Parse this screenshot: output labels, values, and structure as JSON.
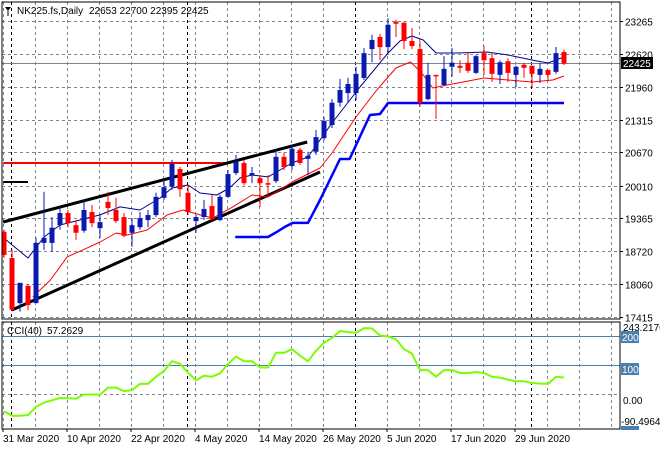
{
  "header": {
    "symbol": "NK225.fs,Daily",
    "ohlc_text": "22653 22700 22395 22425",
    "icon": "triangle-down-icon"
  },
  "colors": {
    "bull": "#0a1ab0",
    "bear": "#ff0000",
    "ma_fast": "#00008b",
    "ma_slow": "#ff0000",
    "support": "#0000ff",
    "cci": "#7cfc00",
    "level": "#4a7fb0",
    "grid": "#7a8590"
  },
  "chart_data": [
    {
      "type": "candlestick",
      "title": "NK225.fs,Daily",
      "ylim": [
        17415,
        23265
      ],
      "y_ticks": [
        "23265",
        "22620",
        "21960",
        "21315",
        "20670",
        "20010",
        "19365",
        "18720",
        "18060",
        "17415"
      ],
      "x_ticks": [
        {
          "i": 0,
          "label": "31 Mar 2020"
        },
        {
          "i": 8,
          "label": "10 Apr 2020"
        },
        {
          "i": 16,
          "label": "22 Apr 2020"
        },
        {
          "i": 24,
          "label": "4 May 2020"
        },
        {
          "i": 32,
          "label": "14 May 2020"
        },
        {
          "i": 40,
          "label": "26 May 2020"
        },
        {
          "i": 48,
          "label": "5 Jun 2020"
        },
        {
          "i": 56,
          "label": "17 Jun 2020"
        },
        {
          "i": 64,
          "label": "29 Jun 2020"
        }
      ],
      "grid": true,
      "month_separators": [
        1,
        23,
        44,
        66
      ],
      "current_price": "22425",
      "candles_ohlc": [
        [
          19100,
          19140,
          18580,
          18640
        ],
        [
          18580,
          18740,
          17540,
          17560
        ],
        [
          17690,
          18090,
          17520,
          18090
        ],
        [
          18030,
          18070,
          17550,
          17650
        ],
        [
          17690,
          18980,
          17690,
          18880
        ],
        [
          18880,
          19890,
          18740,
          18980
        ],
        [
          18880,
          19390,
          18700,
          19180
        ],
        [
          19230,
          19590,
          19140,
          19470
        ],
        [
          19470,
          19530,
          19190,
          19270
        ],
        [
          19230,
          19330,
          18940,
          19080
        ],
        [
          19120,
          19730,
          19080,
          19530
        ],
        [
          19490,
          19630,
          19190,
          19270
        ],
        [
          19170,
          19430,
          18980,
          19290
        ],
        [
          19690,
          19890,
          19430,
          19570
        ],
        [
          19530,
          19770,
          19270,
          19310
        ],
        [
          19390,
          19470,
          18990,
          19020
        ],
        [
          19080,
          19370,
          18800,
          19230
        ],
        [
          19190,
          19490,
          19140,
          19370
        ],
        [
          19330,
          19530,
          19190,
          19430
        ],
        [
          19430,
          19870,
          19390,
          19790
        ],
        [
          19770,
          20120,
          19730,
          19980
        ],
        [
          19990,
          20520,
          19930,
          20440
        ],
        [
          20340,
          20380,
          19790,
          19940
        ],
        [
          19870,
          20020,
          19430,
          19490
        ],
        [
          19310,
          19430,
          19080,
          19390
        ],
        [
          19390,
          19730,
          19330,
          19550
        ],
        [
          19610,
          19830,
          19330,
          19350
        ],
        [
          19330,
          19830,
          19310,
          19790
        ],
        [
          19790,
          20320,
          19770,
          20240
        ],
        [
          20260,
          20620,
          20220,
          20480
        ],
        [
          20460,
          20520,
          20020,
          20060
        ],
        [
          20220,
          20380,
          20060,
          20260
        ],
        [
          20160,
          20220,
          19590,
          20060
        ],
        [
          20060,
          20220,
          19790,
          20030
        ],
        [
          20100,
          20720,
          20060,
          20580
        ],
        [
          20580,
          20660,
          20320,
          20380
        ],
        [
          20400,
          20820,
          20320,
          20740
        ],
        [
          20720,
          20760,
          20420,
          20460
        ],
        [
          20540,
          20680,
          20220,
          20600
        ],
        [
          20680,
          21110,
          20620,
          20970
        ],
        [
          20950,
          21370,
          20910,
          21290
        ],
        [
          21210,
          21720,
          21150,
          21650
        ],
        [
          21650,
          22120,
          21570,
          21900
        ],
        [
          21840,
          22140,
          21650,
          22020
        ],
        [
          21840,
          22360,
          21700,
          22220
        ],
        [
          22140,
          22730,
          22100,
          22630
        ],
        [
          22710,
          22990,
          22450,
          22890
        ],
        [
          22950,
          23010,
          22490,
          22750
        ],
        [
          22750,
          23320,
          22630,
          23190
        ],
        [
          23250,
          23290,
          22950,
          23210
        ],
        [
          23230,
          23250,
          22710,
          22870
        ],
        [
          22870,
          23130,
          22710,
          22770
        ],
        [
          22710,
          22870,
          21570,
          21650
        ],
        [
          21720,
          22440,
          21700,
          22200
        ],
        [
          22200,
          22200,
          21330,
          22180
        ],
        [
          22000,
          22570,
          21980,
          22320
        ],
        [
          22360,
          22730,
          22160,
          22440
        ],
        [
          22380,
          22490,
          22240,
          22340
        ],
        [
          22440,
          22650,
          22240,
          22280
        ],
        [
          22240,
          22590,
          22220,
          22570
        ],
        [
          22630,
          22770,
          22200,
          22490
        ],
        [
          22530,
          22650,
          22060,
          22220
        ],
        [
          22200,
          22490,
          22020,
          22450
        ],
        [
          22470,
          22530,
          22060,
          22240
        ],
        [
          22200,
          22380,
          21960,
          22360
        ],
        [
          22400,
          22440,
          22140,
          22340
        ],
        [
          22380,
          22380,
          21960,
          22220
        ],
        [
          22200,
          22440,
          22040,
          22320
        ],
        [
          22300,
          22300,
          22080,
          22200
        ],
        [
          22260,
          22750,
          22220,
          22630
        ],
        [
          22653,
          22700,
          22395,
          22425
        ]
      ],
      "ma_fast": [
        [
          0,
          18977
        ],
        [
          1,
          18839
        ],
        [
          3,
          18582
        ],
        [
          5,
          18997
        ],
        [
          7,
          19234
        ],
        [
          9.5,
          19333
        ],
        [
          12,
          19432
        ],
        [
          14.5,
          19590
        ],
        [
          17,
          19530
        ],
        [
          19.5,
          19767
        ],
        [
          21,
          19965
        ],
        [
          23,
          20024
        ],
        [
          24.5,
          19866
        ],
        [
          26.6,
          19827
        ],
        [
          28.2,
          19965
        ],
        [
          29.5,
          20163
        ],
        [
          31,
          20222
        ],
        [
          33,
          20183
        ],
        [
          34.5,
          20321
        ],
        [
          36,
          20459
        ],
        [
          38,
          20578
        ],
        [
          41,
          21250
        ],
        [
          44.5,
          21961
        ],
        [
          48,
          22633
        ],
        [
          49.5,
          22870
        ],
        [
          51,
          22969
        ],
        [
          52.4,
          22890
        ],
        [
          54,
          22633
        ],
        [
          56.6,
          22633
        ],
        [
          60.4,
          22652
        ],
        [
          63,
          22593
        ],
        [
          66,
          22494
        ],
        [
          68,
          22435
        ],
        [
          70,
          22553
        ]
      ],
      "ma_slow": [
        [
          3.6,
          17811
        ],
        [
          5.8,
          18147
        ],
        [
          7.9,
          18602
        ],
        [
          10.4,
          18780
        ],
        [
          12,
          18898
        ],
        [
          14,
          19076
        ],
        [
          15.4,
          19036
        ],
        [
          17.9,
          19135
        ],
        [
          20.4,
          19432
        ],
        [
          22.4,
          19530
        ],
        [
          24.5,
          19432
        ],
        [
          26.1,
          19372
        ],
        [
          28.6,
          19590
        ],
        [
          31,
          19827
        ],
        [
          33,
          19787
        ],
        [
          34.5,
          19926
        ],
        [
          36,
          20084
        ],
        [
          39.5,
          20360
        ],
        [
          41,
          20657
        ],
        [
          44,
          21368
        ],
        [
          46.6,
          21901
        ],
        [
          49,
          22336
        ],
        [
          50.8,
          22455
        ],
        [
          51.6,
          22336
        ],
        [
          52.4,
          22198
        ],
        [
          53.6,
          21941
        ],
        [
          55.4,
          22000
        ],
        [
          60,
          22139
        ],
        [
          63,
          22099
        ],
        [
          66,
          22060
        ],
        [
          68.6,
          22099
        ],
        [
          70,
          22178
        ]
      ],
      "support_line": [
        [
          28.9,
          18997
        ],
        [
          33,
          18997
        ],
        [
          34.1,
          19096
        ],
        [
          35.1,
          19195
        ],
        [
          36.1,
          19274
        ],
        [
          38,
          19274
        ],
        [
          39.5,
          19727
        ],
        [
          42,
          20538
        ],
        [
          43.2,
          20538
        ],
        [
          45.75,
          21408
        ],
        [
          47,
          21427
        ],
        [
          48,
          21645
        ],
        [
          70,
          21645
        ]
      ],
      "trendline_upper": [
        [
          -0.1,
          19293
        ],
        [
          37.9,
          20874
        ]
      ],
      "trendline_lower": [
        [
          1,
          17554
        ],
        [
          39.5,
          20281
        ]
      ],
      "resistance_level": [
        [
          -0.1,
          20459
        ],
        [
          27.6,
          20459
        ]
      ],
      "prior_level": [
        [
          -0.1,
          20084
        ],
        [
          3,
          20084
        ]
      ]
    },
    {
      "type": "line",
      "title": "CCI(40)",
      "last_value": "57.2629",
      "ylim": [
        -90.4964,
        243.2176
      ],
      "ylim_labels": [
        "243.2176",
        "-90.4964"
      ],
      "levels": [
        "200",
        "100"
      ],
      "zero_label": "0.00",
      "values": [
        -60,
        -76,
        -76,
        -73,
        -45,
        -30,
        -22,
        -14,
        -15,
        -16,
        -2,
        -2,
        -3,
        22,
        22,
        10,
        13,
        35,
        35,
        60,
        80,
        114,
        105,
        74,
        48,
        63,
        60,
        72,
        104,
        130,
        114,
        114,
        92,
        92,
        143,
        143,
        156,
        133,
        114,
        150,
        178,
        195,
        219,
        215,
        213,
        229,
        228,
        203,
        200,
        190,
        156,
        140,
        83,
        83,
        60,
        83,
        83,
        73,
        73,
        76,
        73,
        60,
        57,
        50,
        44,
        44,
        38,
        36,
        35,
        60,
        57.26
      ]
    }
  ]
}
